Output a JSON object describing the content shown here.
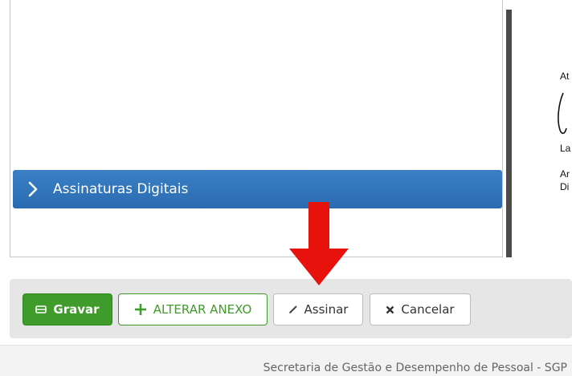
{
  "accordion": {
    "label": "Assinaturas Digitais",
    "icon": "chevron-right-icon"
  },
  "document_preview": {
    "line_att": "At",
    "name_fragment": "La",
    "role_line1": "Ar",
    "role_line2": "Di"
  },
  "toolbar": {
    "gravar_label": "Gravar",
    "alterar_anexo_label": "ALTERAR ANEXO",
    "assinar_label": "Assinar",
    "cancelar_label": "Cancelar"
  },
  "footer": {
    "text": "Secretaria de Gestão e Desempenho de Pessoal - SGP"
  },
  "colors": {
    "accordion_blue": "#2f74bb",
    "primary_green": "#3f9b2a",
    "annotation_red": "#e8120c"
  }
}
